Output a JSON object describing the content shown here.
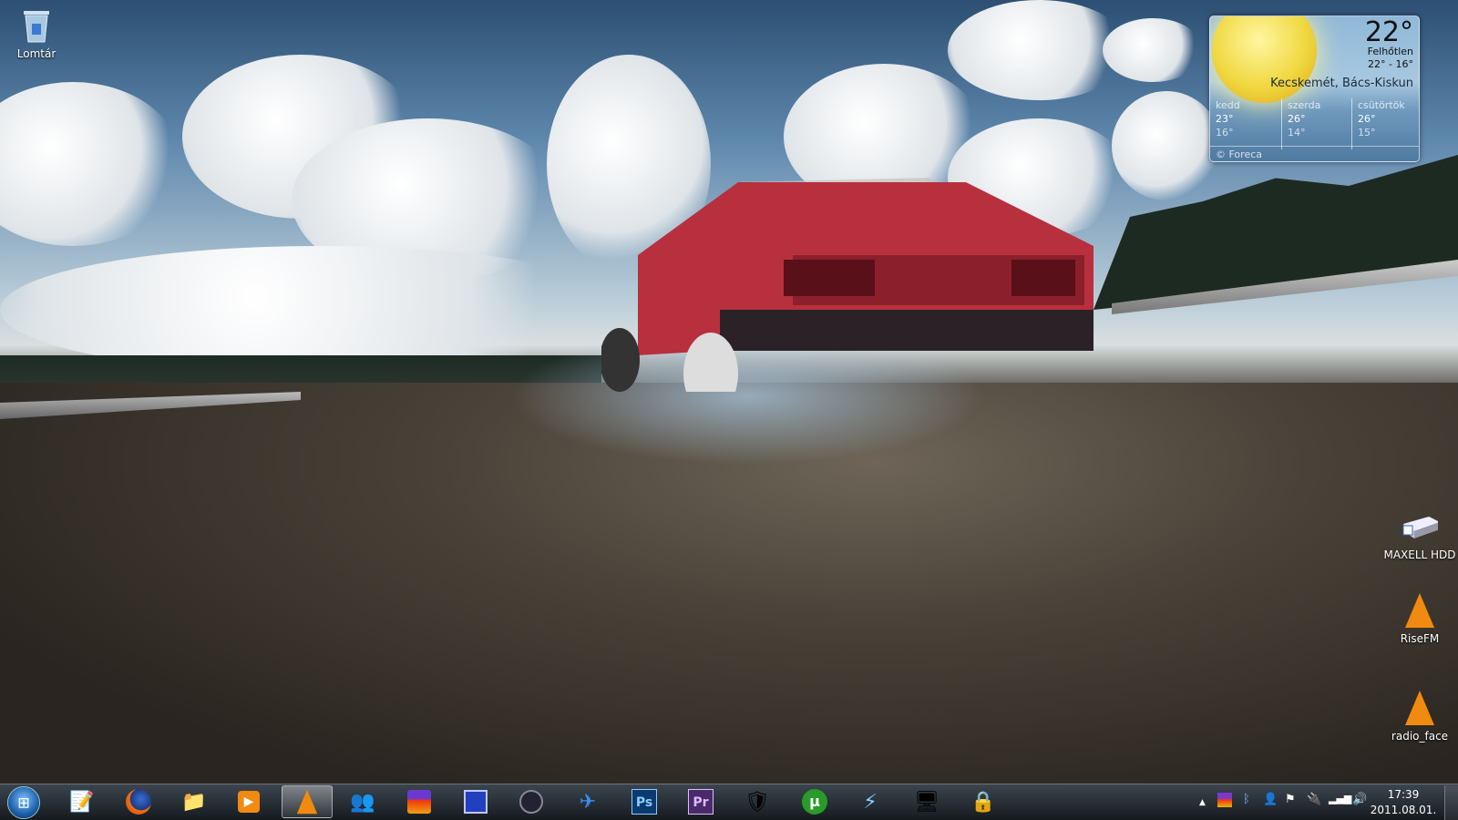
{
  "desktop": {
    "icons": [
      {
        "label": "Lomtár",
        "icon": "recycle-bin-icon"
      },
      {
        "label": "MAXELL HDD",
        "icon": "external-drive-icon"
      },
      {
        "label": "RiseFM",
        "icon": "vlc-cone-icon"
      },
      {
        "label": "radio_face",
        "icon": "vlc-cone-icon"
      }
    ]
  },
  "weather": {
    "temp": "22°",
    "condition": "Felhőtlen",
    "range": "22° - 16°",
    "location": "Kecskemét, Bács-Kiskun",
    "forecast": [
      {
        "day": "kedd",
        "high": "23°",
        "low": "16°",
        "icon": "rain-icon"
      },
      {
        "day": "szerda",
        "high": "26°",
        "low": "14°",
        "icon": "cloud-icon"
      },
      {
        "day": "csütörtök",
        "high": "26°",
        "low": "15°",
        "icon": "cloud-icon"
      }
    ],
    "credit": "© Foreca"
  },
  "taskbar": {
    "apps": [
      "Notepad",
      "Firefox",
      "Windows Explorer",
      "Media Player",
      "VLC media player",
      "Messenger",
      "Winamp",
      "Save",
      "Steam",
      "Messenger Plus",
      "Photoshop",
      "Premiere",
      "Network",
      "uTorrent",
      "Daemon Tools",
      "Monitor",
      "Security"
    ],
    "ps_label": "Ps",
    "pr_label": "Pr",
    "time": "17:39",
    "date": "2011.08.01."
  },
  "colors": {
    "accent": "#1d5fa8",
    "ps": "#0a3a6e",
    "pr": "#4a2a6a"
  }
}
